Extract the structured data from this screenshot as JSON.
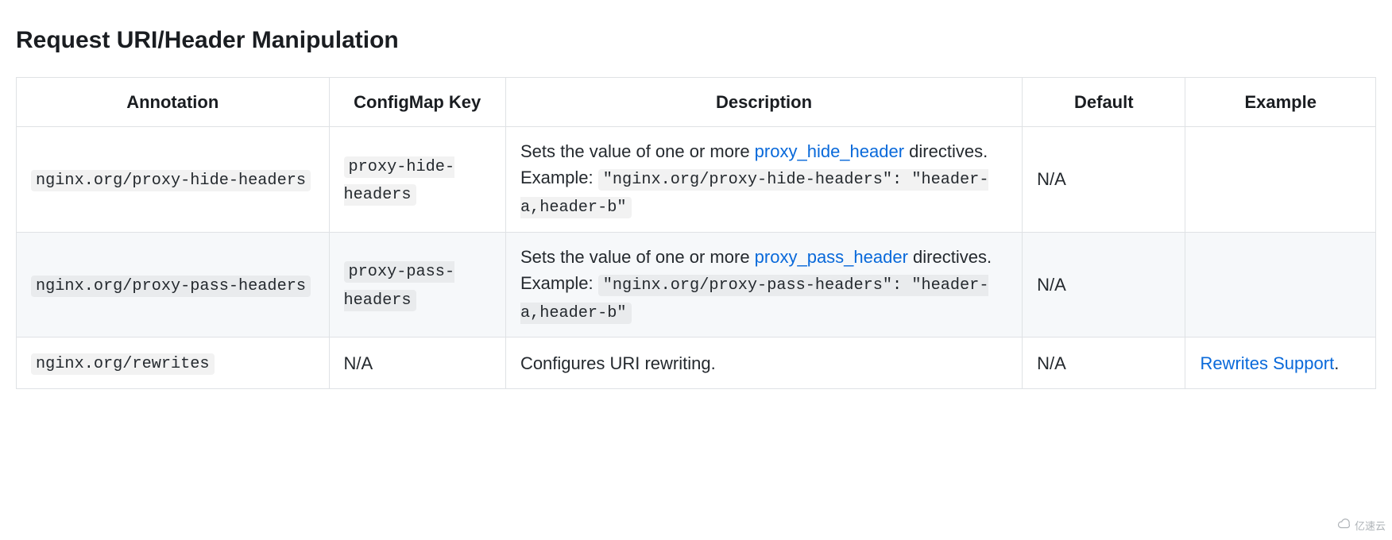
{
  "heading": "Request URI/Header Manipulation",
  "columns": {
    "annotation": "Annotation",
    "configmap": "ConfigMap Key",
    "description": "Description",
    "default": "Default",
    "example": "Example"
  },
  "rows": [
    {
      "annotation_code": "nginx.org/proxy-hide-headers",
      "configmap_code": "proxy-hide-headers",
      "desc_prefix": "Sets the value of one or more ",
      "desc_link": "proxy_hide_header",
      "desc_mid": " directives. Example: ",
      "desc_example_code": "\"nginx.org/proxy-hide-headers\": \"header-a,header-b\"",
      "default": "N/A",
      "example_text": "",
      "example_link": ""
    },
    {
      "annotation_code": "nginx.org/proxy-pass-headers",
      "configmap_code": "proxy-pass-headers",
      "desc_prefix": "Sets the value of one or more ",
      "desc_link": "proxy_pass_header",
      "desc_mid": " directives. Example: ",
      "desc_example_code": "\"nginx.org/proxy-pass-headers\": \"header-a,header-b\"",
      "default": "N/A",
      "example_text": "",
      "example_link": ""
    },
    {
      "annotation_code": "nginx.org/rewrites",
      "configmap_text": "N/A",
      "desc_plain": "Configures URI rewriting.",
      "default": "N/A",
      "example_link": "Rewrites Support",
      "example_suffix": "."
    }
  ],
  "watermark": "亿速云"
}
